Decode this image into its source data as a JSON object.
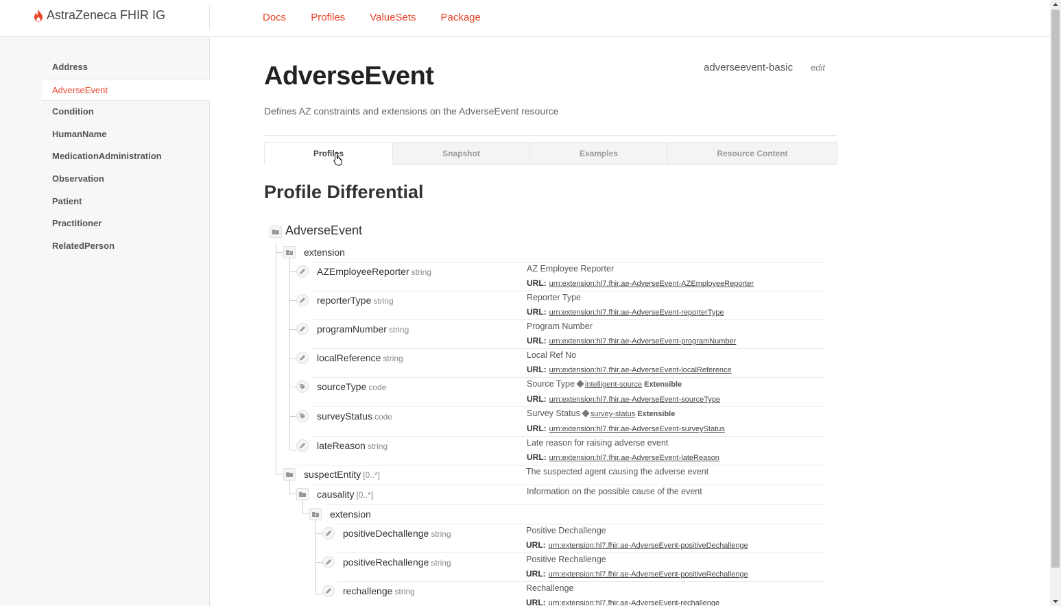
{
  "header": {
    "brand": "AstraZeneca FHIR IG",
    "nav": [
      "Docs",
      "Profiles",
      "ValueSets",
      "Package"
    ]
  },
  "sidebar": {
    "items": [
      "Address",
      "AdverseEvent",
      "Condition",
      "HumanName",
      "MedicationAdministration",
      "Observation",
      "Patient",
      "Practitioner",
      "RelatedPerson"
    ],
    "active": "AdverseEvent"
  },
  "page": {
    "title": "AdverseEvent",
    "id": "adverseevent-basic",
    "edit": "edit",
    "description": "Defines AZ constraints and extensions on the AdverseEvent resource"
  },
  "tabs": [
    "Profiles",
    "Snapshot",
    "Examples",
    "Resource Content"
  ],
  "active_tab": "Profiles",
  "section_title": "Profile Differential",
  "url_label": "URL:",
  "tree": {
    "root": "AdverseEvent",
    "extension_label": "extension",
    "extensions": [
      {
        "name": "AZEmployeeReporter",
        "type": "string",
        "desc": "AZ Employee Reporter",
        "url": "urn:extension:hl7.fhir.ae-AdverseEvent-AZEmployeeReporter"
      },
      {
        "name": "reporterType",
        "type": "string",
        "desc": "Reporter Type",
        "url": "urn:extension:hl7.fhir.ae-AdverseEvent-reporterType"
      },
      {
        "name": "programNumber",
        "type": "string",
        "desc": "Program Number",
        "url": "urn:extension:hl7.fhir.ae-AdverseEvent-programNumber"
      },
      {
        "name": "localReference",
        "type": "string",
        "desc": "Local Ref No",
        "url": "urn:extension:hl7.fhir.ae-AdverseEvent-localReference"
      },
      {
        "name": "sourceType",
        "type": "code",
        "desc": "Source Type",
        "binding": "intelligent-source",
        "strength": "Extensible",
        "url": "urn:extension:hl7.fhir.ae-AdverseEvent-sourceType"
      },
      {
        "name": "surveyStatus",
        "type": "code",
        "desc": "Survey Status",
        "binding": "survey-status",
        "strength": "Extensible",
        "url": "urn:extension:hl7.fhir.ae-AdverseEvent-surveyStatus"
      },
      {
        "name": "lateReason",
        "type": "string",
        "desc": "Late reason for raising adverse event",
        "url": "urn:extension:hl7.fhir.ae-AdverseEvent-lateReason"
      }
    ],
    "suspectEntity": {
      "name": "suspectEntity",
      "card": "[0..*]",
      "desc": "The suspected agent causing the adverse event"
    },
    "causality": {
      "name": "causality",
      "card": "[0..*]",
      "desc": "Information on the possible cause of the event"
    },
    "causality_extension_label": "extension",
    "causality_extensions": [
      {
        "name": "positiveDechallenge",
        "type": "string",
        "desc": "Positive Dechallenge",
        "url": "urn:extension:hl7.fhir.ae-AdverseEvent-positiveDechallenge"
      },
      {
        "name": "positiveRechallenge",
        "type": "string",
        "desc": "Positive Rechallenge",
        "url": "urn:extension:hl7.fhir.ae-AdverseEvent-positiveRechallenge"
      },
      {
        "name": "rechallenge",
        "type": "string",
        "desc": "Rechallenge",
        "url": "urn:extension:hl7.fhir.ae-AdverseEvent-rechallenge"
      }
    ]
  },
  "colors": {
    "accent": "#e8452b",
    "text": "#333333",
    "sidebar_bg": "#f7f7f7"
  }
}
